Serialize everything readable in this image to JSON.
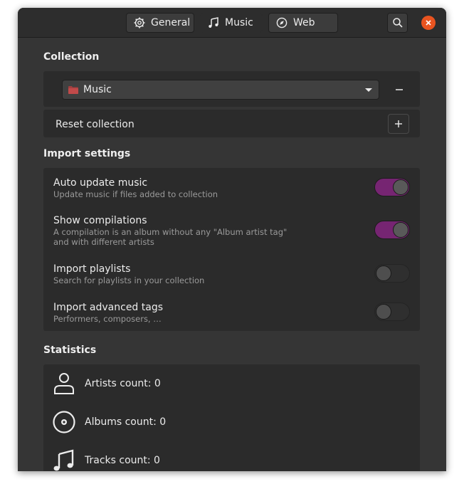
{
  "header": {
    "tabs": [
      {
        "label": "General",
        "icon": "gear-icon",
        "active": false
      },
      {
        "label": "Music",
        "icon": "music-note-icon",
        "active": true
      },
      {
        "label": "Web",
        "icon": "compass-icon",
        "active": false
      }
    ],
    "search_icon": "search-icon",
    "close_icon": "close-icon"
  },
  "collection": {
    "title": "Collection",
    "folder": "Music",
    "reset_label": "Reset collection"
  },
  "import": {
    "title": "Import settings",
    "items": [
      {
        "title": "Auto update music",
        "subtitle": "Update music if files added to collection",
        "on": true
      },
      {
        "title": "Show compilations",
        "subtitle": "A compilation is an album without any \"Album artist tag\"",
        "subtitle2": "and with different artists",
        "on": true
      },
      {
        "title": "Import playlists",
        "subtitle": "Search for playlists in your collection",
        "on": false
      },
      {
        "title": "Import advanced tags",
        "subtitle": "Performers, composers, …",
        "on": false
      }
    ]
  },
  "statistics": {
    "title": "Statistics",
    "items": [
      {
        "label": "Artists count: 0",
        "icon": "person-icon"
      },
      {
        "label": "Albums count: 0",
        "icon": "disc-icon"
      },
      {
        "label": "Tracks count: 0",
        "icon": "music-note-icon"
      }
    ]
  },
  "colors": {
    "accent": "#762572",
    "close": "#e95420",
    "window_bg": "#353535",
    "panel_bg": "#2b2b2b"
  }
}
